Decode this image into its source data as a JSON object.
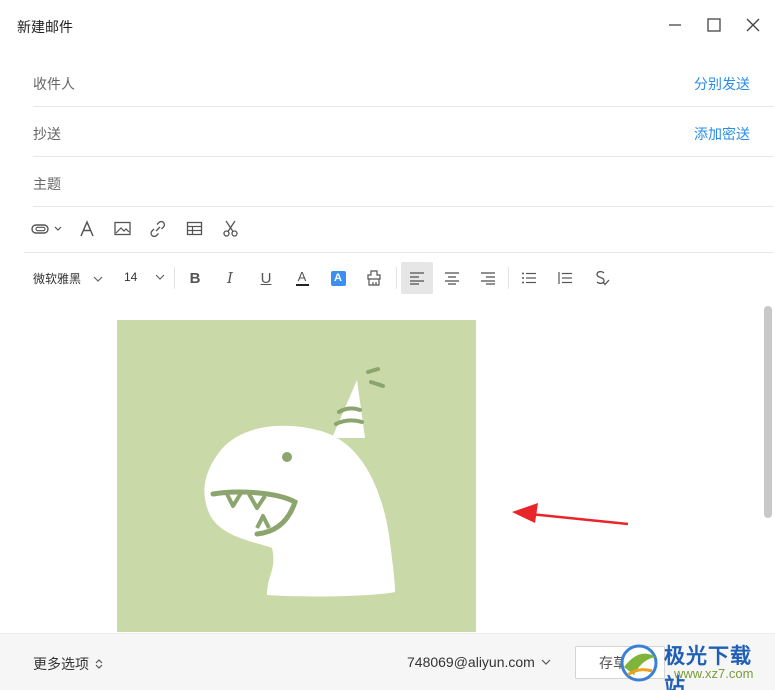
{
  "window": {
    "title": "新建邮件",
    "controls": [
      "minimize-icon",
      "maximize-icon",
      "close-icon"
    ]
  },
  "fields": {
    "to": {
      "label": "收件人",
      "link": "分别发送"
    },
    "cc": {
      "label": "抄送",
      "link": "添加密送"
    },
    "subject": {
      "label": "主题"
    }
  },
  "toolbar": {
    "icons": [
      "attachment-icon",
      "font-icon",
      "image-icon",
      "link-icon",
      "table-icon",
      "scissors-icon"
    ],
    "font_family": "微软雅黑",
    "font_size": "14",
    "format": {
      "bold": "B",
      "italic": "I",
      "underline": "U",
      "font_color": "A",
      "highlight": "A",
      "alignment": "left"
    },
    "colors": {
      "highlight_bg": "#3a8ff0",
      "font_color_bar": "#222222"
    }
  },
  "editor": {
    "image_bg": "#c9d9a7",
    "arrow_color": "#e8262a"
  },
  "footer": {
    "more_options": "更多选项",
    "account": "748069@aliyun.com",
    "save_draft": "存草稿"
  },
  "watermark": {
    "text": "极光下载站",
    "url": "www.xz7.com"
  },
  "colors": {
    "link": "#2a8ee8",
    "footer_bg": "#f6f6f6"
  }
}
